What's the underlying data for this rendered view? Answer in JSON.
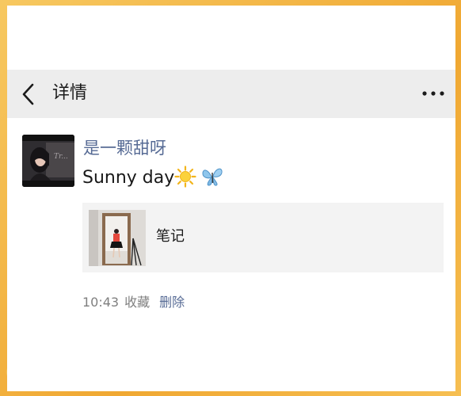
{
  "header": {
    "title": "详情"
  },
  "post": {
    "username": "是一颗甜呀",
    "text": "Sunny day",
    "emojis": [
      "sun-icon",
      "butterfly-icon"
    ],
    "card": {
      "title": "笔记"
    },
    "meta": {
      "time": "10:43",
      "favorite_label": "收藏",
      "delete_label": "删除"
    }
  },
  "colors": {
    "link_blue": "#576b95",
    "navbar_bg": "#ededed",
    "card_bg": "#f3f3f3",
    "frame_orange": "#f4b63e"
  }
}
